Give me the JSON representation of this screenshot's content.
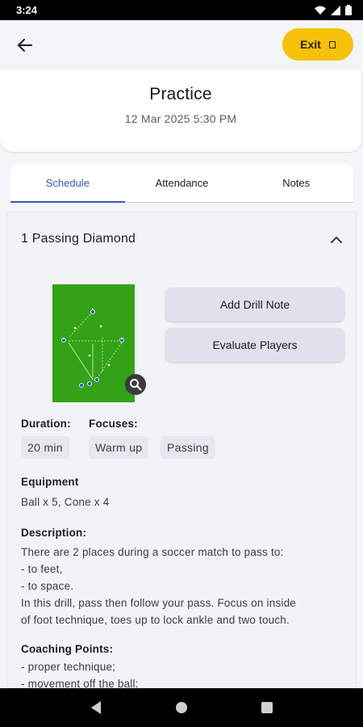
{
  "status": {
    "time": "3:24"
  },
  "header": {
    "exit_label": "Exit",
    "title": "Practice",
    "datetime": "12 Mar 2025 5:30 PM"
  },
  "tabs": [
    {
      "label": "Schedule",
      "active": true
    },
    {
      "label": "Attendance"
    },
    {
      "label": "Notes"
    }
  ],
  "drill": {
    "title": "1 Passing Diamond",
    "actions": {
      "add_note": "Add Drill Note",
      "evaluate": "Evaluate Players"
    },
    "duration_label": "Duration:",
    "duration_value": "20 min",
    "focuses_label": "Focuses:",
    "focuses": [
      "Warm up",
      "Passing"
    ],
    "equipment_label": "Equipment",
    "equipment_value": "Ball x 5, Cone x 4",
    "description_label": "Description:",
    "description_lines": [
      "There are 2 places during a soccer match to pass to:",
      "- to feet,",
      "- to space.",
      "In this drill, pass then follow your pass. Focus on inside",
      "of foot technique, toes up to lock ankle and two touch."
    ],
    "coaching_label": "Coaching Points:",
    "coaching_lines": [
      "- proper technique;",
      "- movement off the ball;"
    ]
  },
  "colors": {
    "accent": "#3a58b8",
    "exit": "#f5c20b",
    "pitch": "#34a217"
  }
}
